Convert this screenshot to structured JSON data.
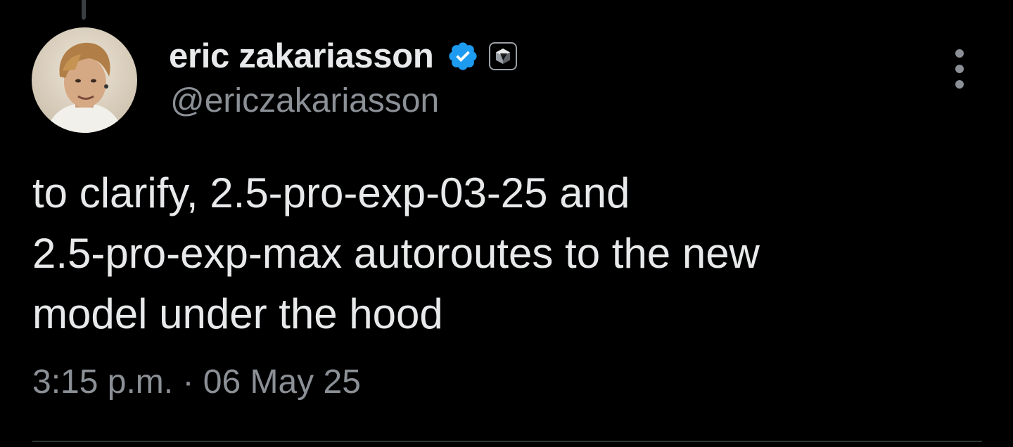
{
  "tweet": {
    "author": {
      "display_name": "eric zakariasson",
      "handle": "@ericzakariasson",
      "verified": true,
      "badge_icon": "affiliate-cube-icon",
      "verified_color": "#1d9bf0"
    },
    "text": "to clarify, 2.5-pro-exp-03-25 and\n2.5-pro-exp-max autoroutes to the new\nmodel under the hood",
    "timestamp": "3:15 p.m. · 06 May 25",
    "more_icon": "more-vertical-icon"
  },
  "theme": {
    "background": "#000000",
    "text_primary": "#e7e9ea",
    "text_secondary": "#8b9096",
    "divider": "#2f3336"
  }
}
